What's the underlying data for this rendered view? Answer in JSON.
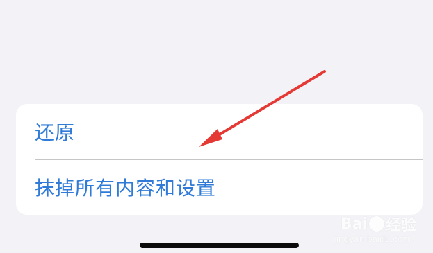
{
  "settings_group": {
    "items": [
      {
        "label": "还原"
      },
      {
        "label": "抹掉所有内容和设置"
      }
    ]
  },
  "watermark": {
    "brand": "Bai",
    "suffix": "经验",
    "subtext": "jingyan.baidu.com"
  },
  "colors": {
    "background": "#f2f2f7",
    "card": "#ffffff",
    "link_blue": "#2f7bd7",
    "separator": "#c6c6c8",
    "annotation_arrow": "#e53935",
    "home_indicator": "#0b0b0b"
  }
}
